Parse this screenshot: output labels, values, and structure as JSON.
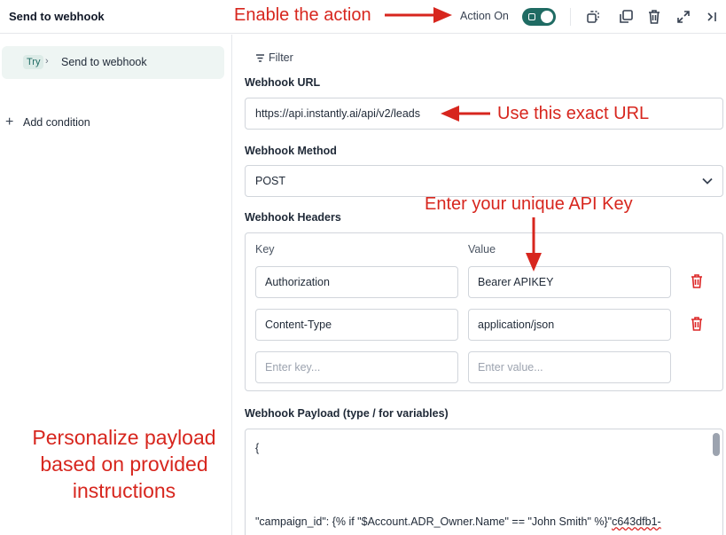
{
  "header": {
    "title": "Send to webhook",
    "action_label": "Action On",
    "toggle_on": true,
    "icons": [
      "copy-icon",
      "duplicate-icon",
      "trash-icon",
      "expand-icon",
      "collapse-panel-icon"
    ]
  },
  "sidebar": {
    "branch": {
      "badge": "Try",
      "name": "Send to webhook"
    },
    "add_condition": "Add condition"
  },
  "main": {
    "filter_label": "Filter",
    "url": {
      "label": "Webhook URL",
      "value": "https://api.instantly.ai/api/v2/leads"
    },
    "method": {
      "label": "Webhook Method",
      "value": "POST"
    },
    "headers": {
      "label": "Webhook Headers",
      "key_col": "Key",
      "value_col": "Value",
      "rows": [
        {
          "key": "Authorization",
          "value": "Bearer APIKEY"
        },
        {
          "key": "Content-Type",
          "value": "application/json"
        }
      ],
      "key_placeholder": "Enter key...",
      "value_placeholder": "Enter value..."
    },
    "payload": {
      "label": "Webhook Payload (type / for variables)",
      "line1": "{",
      "line2_prefix": "\"campaign_id\": {% if \"$Account.ADR_Owner.Name\" == \"John Smith\" %}\"",
      "line2_id": "c643dfb1-"
    }
  },
  "annotations": {
    "enable": "Enable the action",
    "url": "Use this exact URL",
    "apikey": "Enter your unique API Key",
    "payload": "Personalize payload based on provided instructions"
  },
  "colors": {
    "accent": "#1f6b63",
    "annotation": "#d7261e",
    "delete": "#dc2626"
  }
}
